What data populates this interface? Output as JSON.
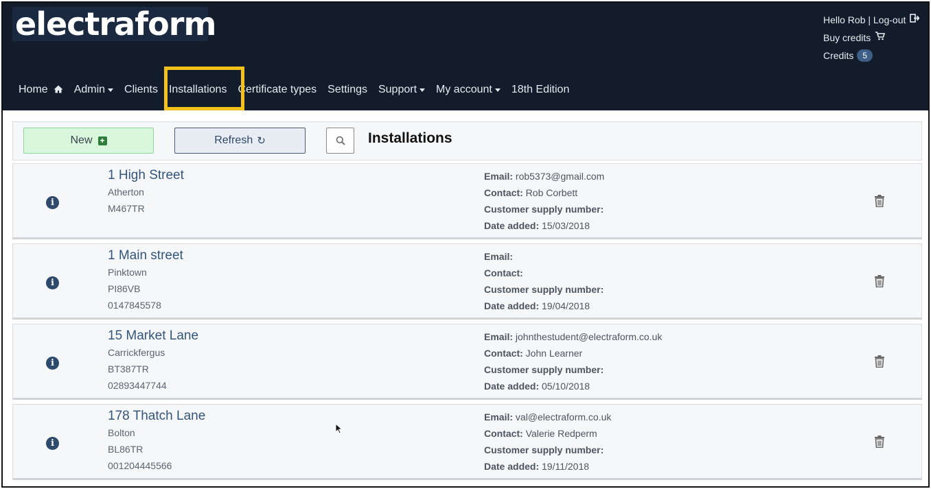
{
  "brand": {
    "logo_text": "electraform"
  },
  "user": {
    "greeting": "Hello Rob | Log-out",
    "buy_credits": "Buy credits",
    "credits_label": "Credits",
    "credits_count": "5"
  },
  "nav": {
    "home": "Home",
    "admin": "Admin",
    "clients": "Clients",
    "installations": "Installations",
    "certificate_types": "Certificate types",
    "settings": "Settings",
    "support": "Support",
    "my_account": "My account",
    "edition": "18th Edition"
  },
  "toolbar": {
    "new_label": "New",
    "refresh_label": "Refresh",
    "title": "Installations"
  },
  "labels": {
    "email": "Email:",
    "contact": "Contact:",
    "supply": "Customer supply number:",
    "date_added": "Date added:"
  },
  "installations": [
    {
      "name": "1 High Street",
      "town": "Atherton",
      "postcode": "M467TR",
      "phone": "",
      "email": "rob5373@gmail.com",
      "contact": "Rob Corbett",
      "supply": "",
      "date_added": "15/03/2018"
    },
    {
      "name": "1 Main street",
      "town": "Pinktown",
      "postcode": "PI86VB",
      "phone": "0147845578",
      "email": "",
      "contact": "",
      "supply": "",
      "date_added": "19/04/2018"
    },
    {
      "name": "15 Market Lane",
      "town": "Carrickfergus",
      "postcode": "BT387TR",
      "phone": "02893447744",
      "email": "johnthestudent@electraform.co.uk",
      "contact": "John Learner",
      "supply": "",
      "date_added": "05/10/2018"
    },
    {
      "name": "178 Thatch Lane",
      "town": "Bolton",
      "postcode": "BL86TR",
      "phone": "001204445566",
      "email": "val@electraform.co.uk",
      "contact": "Valerie Redperm",
      "supply": "",
      "date_added": "19/11/2018"
    }
  ],
  "colors": {
    "header_bg": "#121c2a",
    "highlight": "#f4c21b",
    "link": "#33557a",
    "new_bg": "#d8f7dc"
  },
  "icons": {
    "home": "home-icon",
    "logout": "logout-icon",
    "cart": "cart-icon",
    "info": "info-icon",
    "trash": "trash-icon",
    "search": "search-icon",
    "refresh": "refresh-icon",
    "plus": "plus-square-icon"
  }
}
